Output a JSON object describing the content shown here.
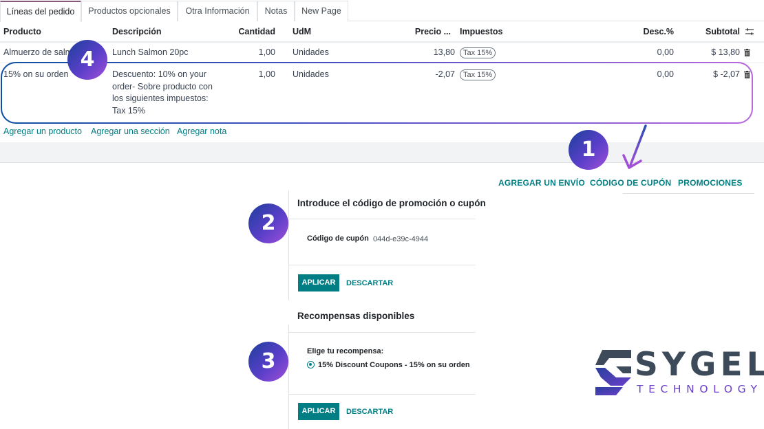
{
  "tabs": [
    "Líneas del pedido",
    "Productos opcionales",
    "Otra Información",
    "Notas",
    "New Page"
  ],
  "table": {
    "headers": {
      "product": "Producto",
      "description": "Descripción",
      "quantity": "Cantidad",
      "uom": "UdM",
      "price": "Precio ...",
      "taxes": "Impuestos",
      "discount": "Desc.%",
      "subtotal": "Subtotal"
    },
    "rows": [
      {
        "product": "Almuerzo de salm",
        "description": "Lunch Salmon 20pc",
        "quantity": "1,00",
        "uom": "Unidades",
        "price": "13,80",
        "tax": "Tax 15%",
        "discount": "0,00",
        "subtotal": "$ 13,80"
      },
      {
        "product": "15% on su orden",
        "description_lines": [
          "Descuento: 10% on your",
          "order- Sobre producto con",
          "los siguientes impuestos:",
          "Tax 15%"
        ],
        "quantity": "1,00",
        "uom": "Unidades",
        "price": "-2,07",
        "tax": "Tax 15%",
        "discount": "0,00",
        "subtotal": "$ -2,07"
      }
    ],
    "links": {
      "add_product": "Agregar un producto",
      "add_section": "Agregar una sección",
      "add_note": "Agregar nota"
    }
  },
  "actions": {
    "shipping": "AGREGAR UN ENVÍO",
    "coupon": "CÓDIGO DE CUPÓN",
    "promotions": "PROMOCIONES"
  },
  "coupon_dialog": {
    "title": "Introduce el código de promoción o cupón",
    "field_label": "Código de cupón",
    "field_value": "044d-e39c-4944",
    "apply": "APLICAR",
    "discard": "DESCARTAR"
  },
  "reward_dialog": {
    "title": "Recompensas disponibles",
    "prompt": "Elige tu recompensa:",
    "option": "15% Discount Coupons - 15% on su orden",
    "apply": "APLICAR",
    "discard": "DESCARTAR"
  },
  "markers": [
    "1",
    "2",
    "3",
    "4"
  ],
  "logo": {
    "word": "SYGEL",
    "tagline": "TECHNOLOGY"
  },
  "icons": {
    "trash": "trash-icon",
    "columns": "column-settings-icon",
    "arrow": "pointer-arrow-icon",
    "logo_mark": "sygel-logo-icon"
  },
  "colors": {
    "accent": "#017e84",
    "tab_active": "#875a7b",
    "marker_start": "#1b3f9a",
    "marker_end": "#a24fd8",
    "logo_grey": "#3d4a5a",
    "logo_violet": "#6a3fc9"
  }
}
